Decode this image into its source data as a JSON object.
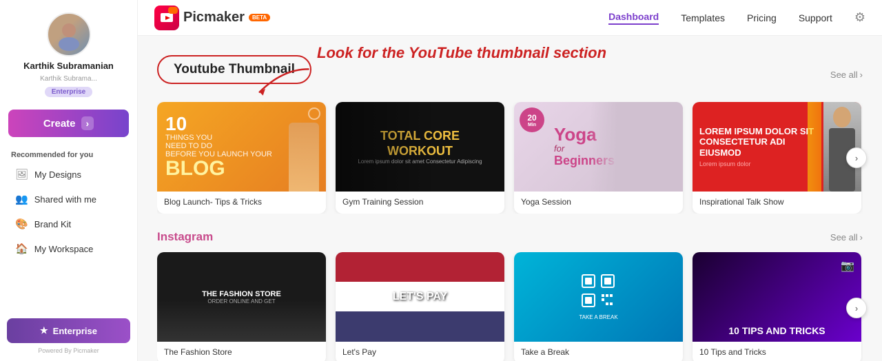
{
  "logo": {
    "name": "Picmaker",
    "beta": "BETA"
  },
  "nav": {
    "links": [
      "Dashboard",
      "Templates",
      "Pricing",
      "Support"
    ],
    "active": "Dashboard",
    "settings_icon": "⚙"
  },
  "sidebar": {
    "profile": {
      "name": "Karthik Subramanian",
      "email": "Karthik Subrama...",
      "badge": "Enterprise"
    },
    "create_label": "Create",
    "section_label": "Recommended for you",
    "items": [
      {
        "id": "my-designs",
        "label": "My Designs",
        "icon": "🖼"
      },
      {
        "id": "shared-with-me",
        "label": "Shared with me",
        "icon": "👥"
      },
      {
        "id": "brand-kit",
        "label": "Brand Kit",
        "icon": "🎨"
      },
      {
        "id": "my-workspace",
        "label": "My Workspace",
        "icon": "🏠"
      }
    ],
    "enterprise_btn": "Enterprise",
    "powered_by": "Powered By Picmaker"
  },
  "annotation": {
    "text": "Look for the YouTube thumbnail section"
  },
  "youtube_section": {
    "title": "Youtube Thumbnail",
    "see_all": "See all",
    "cards": [
      {
        "id": "blog-launch",
        "label": "Blog Launch- Tips & Tricks",
        "theme": "blog"
      },
      {
        "id": "gym-training",
        "label": "Gym Training Session",
        "theme": "gym"
      },
      {
        "id": "yoga-session",
        "label": "Yoga Session",
        "theme": "yoga"
      },
      {
        "id": "inspirational-talk",
        "label": "Inspirational Talk Show",
        "theme": "insp"
      }
    ]
  },
  "instagram_section": {
    "title": "Instagram",
    "see_all": "See all",
    "cards": [
      {
        "id": "fashion-store",
        "label": "The Fashion Store",
        "theme": "fashion"
      },
      {
        "id": "lets-pay",
        "label": "Let's Pay",
        "theme": "flag"
      },
      {
        "id": "take-break",
        "label": "Take a Break",
        "theme": "qr"
      },
      {
        "id": "tips-tricks",
        "label": "10 Tips and Tricks",
        "theme": "tips"
      }
    ]
  },
  "thumb_texts": {
    "blog": {
      "num": "10",
      "line1": "THINGS YOU",
      "line2": "NEED TO DO",
      "line3": "BEFORE YOU LAUNCH YOUR",
      "blog": "BLOG"
    },
    "gym": {
      "title": "TOTAL CORE",
      "title2": "WORKOUT",
      "sub": "Lorem ipsum dolor sit amet Consectetur Adipiscing"
    },
    "yoga": {
      "badge_num": "20",
      "badge_unit": "Min",
      "title": "Yoga",
      "for": "for",
      "beginners": "Beginners"
    },
    "insp": {
      "line1": "LOREM IPSUM DOLOR SIT",
      "line2": "CONSECTETUR ADI",
      "line3": "EIUSMOD",
      "sub": "Lorem ipsum dolor"
    },
    "fashion": {
      "title": "THE FASHION STORE",
      "sub": "ORDER ONLINE AND GET"
    },
    "flag": {
      "text": "LET'S PAY"
    },
    "qr": {
      "text": "TAKE A BREAK"
    },
    "tips": {
      "text": "10 TIPS AND TRICKS"
    }
  }
}
